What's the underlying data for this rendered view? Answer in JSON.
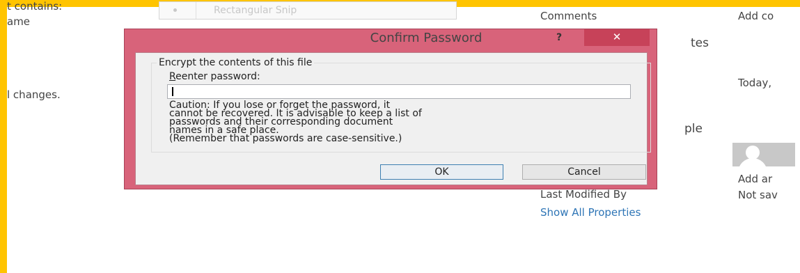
{
  "background": {
    "left_texts": [
      "t contains:",
      "ame",
      "l changes."
    ],
    "snip_button_label": "Rectangular Snip",
    "props": {
      "comments_label": "Comments",
      "comments_value": "Add co",
      "dates_heading_partial": "tes",
      "date_value": "Today,",
      "people_heading_partial": "ple",
      "add_author": "Add ar",
      "last_modified_label": "Last Modified By",
      "last_modified_value": "Not sav",
      "show_all_link": "Show All Properties"
    }
  },
  "dialog": {
    "title": "Confirm Password",
    "help_symbol": "?",
    "close_symbol": "✕",
    "group_label": "Encrypt the contents of this file",
    "field_label_accel": "R",
    "field_label_rest": "eenter password:",
    "password_value": "",
    "caution_text": "Caution: If you lose or forget the password, it\ncannot be recovered. It is advisable to keep a list of\npasswords and their corresponding document\nnames in a safe place.\n(Remember that passwords are case-sensitive.)",
    "ok_label": "OK",
    "cancel_label": "Cancel"
  },
  "colors": {
    "frame": "#ffc400",
    "dialog_frame": "#d8637a",
    "close_button": "#c74259",
    "link": "#2e75b6"
  }
}
